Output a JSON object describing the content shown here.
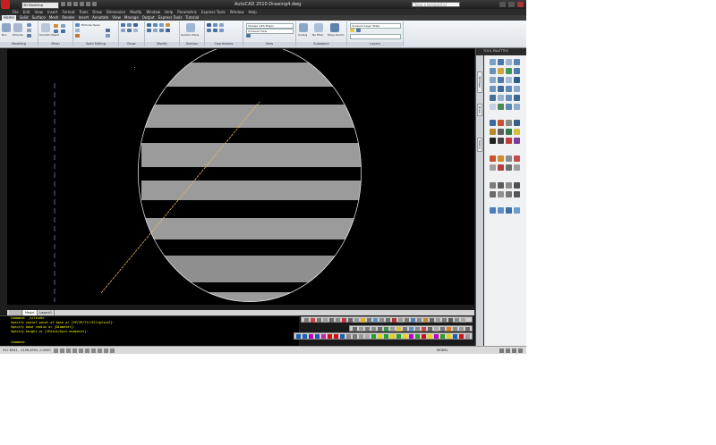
{
  "window": {
    "title": "AutoCAD 2010   Drawing4.dwg",
    "search_placeholder": "Type a keyword or phrase",
    "workspace": "3D Modeling"
  },
  "menubar": [
    "File",
    "Edit",
    "View",
    "Insert",
    "Format",
    "Tools",
    "Draw",
    "Dimension",
    "Modify",
    "Window",
    "Help",
    "Parametric",
    "Express Tools",
    "Window",
    "Help"
  ],
  "ribbon_tabs": {
    "active": "Home",
    "others": [
      "Solid",
      "Surface",
      "Mesh",
      "Render",
      "Insert",
      "Annotate",
      "View",
      "Manage",
      "Output",
      "Express Tools",
      "Tutorial"
    ]
  },
  "ribbon_panels": [
    {
      "label": "Modeling"
    },
    {
      "label": "Mesh"
    },
    {
      "label": "Solid Editing"
    },
    {
      "label": "Draw"
    },
    {
      "label": "Modify"
    },
    {
      "label": "Section"
    },
    {
      "label": "Coordinates"
    },
    {
      "label": "View"
    },
    {
      "label": "Subobject"
    },
    {
      "label": "Layers"
    }
  ],
  "ribbon_small": {
    "box": "Box",
    "extrude": "Extrude",
    "smooth_object": "Smooth Object",
    "extrude_faces": "Extrude faces",
    "section_plane": "Section Plane",
    "culling": "Culling",
    "no_filter": "No Filter",
    "move_gizmo": "Move Gizmo",
    "visual_style": "Shaded with Edges",
    "view": "Unsaved View",
    "layer": "Unsaved Layer State"
  },
  "palette": {
    "title": "TOOL PALETTES",
    "tabs": [
      "3D Make",
      "Draw",
      "Modify"
    ]
  },
  "layout_tabs": [
    "Model",
    "Layout1"
  ],
  "command_lines": [
    "Command: _cylinder",
    "Specify center point of base or [3P/2P/Ttr/Elliptical]:",
    "Specify base radius or [Diameter]:",
    "Specify height or [2Point/Axis endpoint]:"
  ],
  "command_prompt": "Command:",
  "status": {
    "coords": "327.8341, -1156.4955, 0.0000",
    "model": "MODEL"
  },
  "colors": {
    "app_background": "#1a1a1a",
    "canvas": "#000000",
    "cylinder_fill": "#9b9b9b",
    "cylinder_edge": "#e8e8e8",
    "diagonal_line": "#e7b86a",
    "command_text": "#ffff00"
  }
}
